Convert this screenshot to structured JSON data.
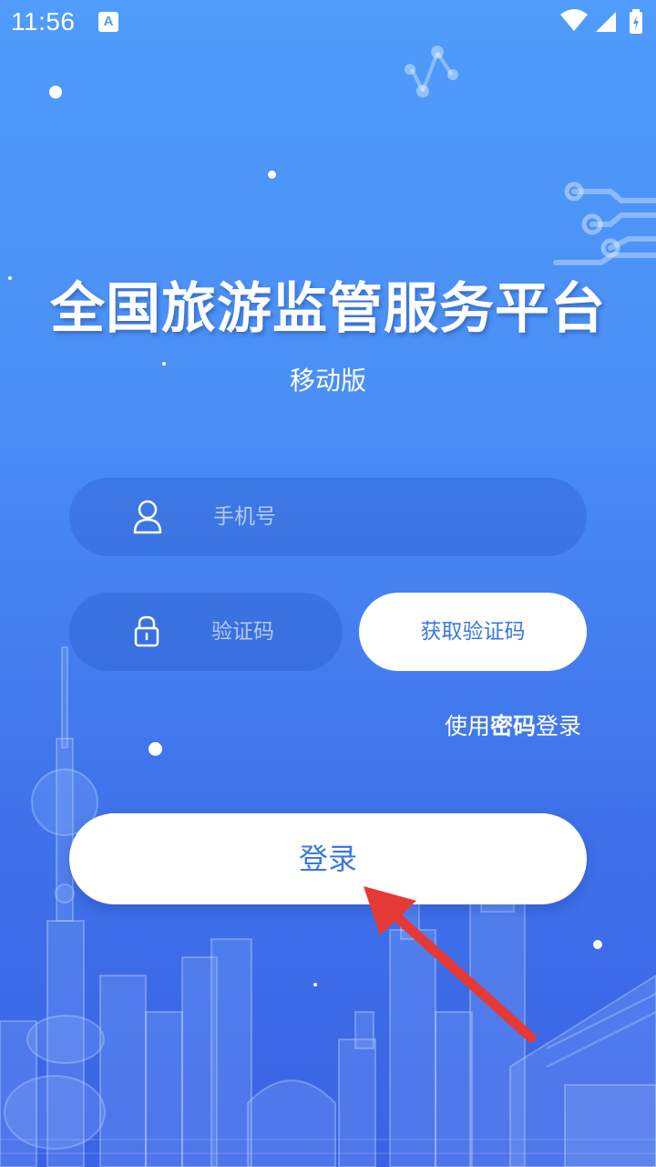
{
  "status_bar": {
    "time": "11:56",
    "notification_icon": "A"
  },
  "header": {
    "title": "全国旅游监管服务平台",
    "subtitle": "移动版"
  },
  "form": {
    "phone_placeholder": "手机号",
    "code_placeholder": "验证码",
    "get_code_label": "获取验证码",
    "password_login_prefix": "使用",
    "password_login_bold": "密码",
    "password_login_suffix": "登录",
    "login_label": "登录"
  },
  "colors": {
    "accent": "#3b78e0",
    "annotation_arrow": "#e53935"
  },
  "icons": {
    "user": "user-icon",
    "lock": "lock-icon",
    "wifi": "wifi-icon",
    "signal": "signal-icon",
    "battery": "battery-icon"
  }
}
